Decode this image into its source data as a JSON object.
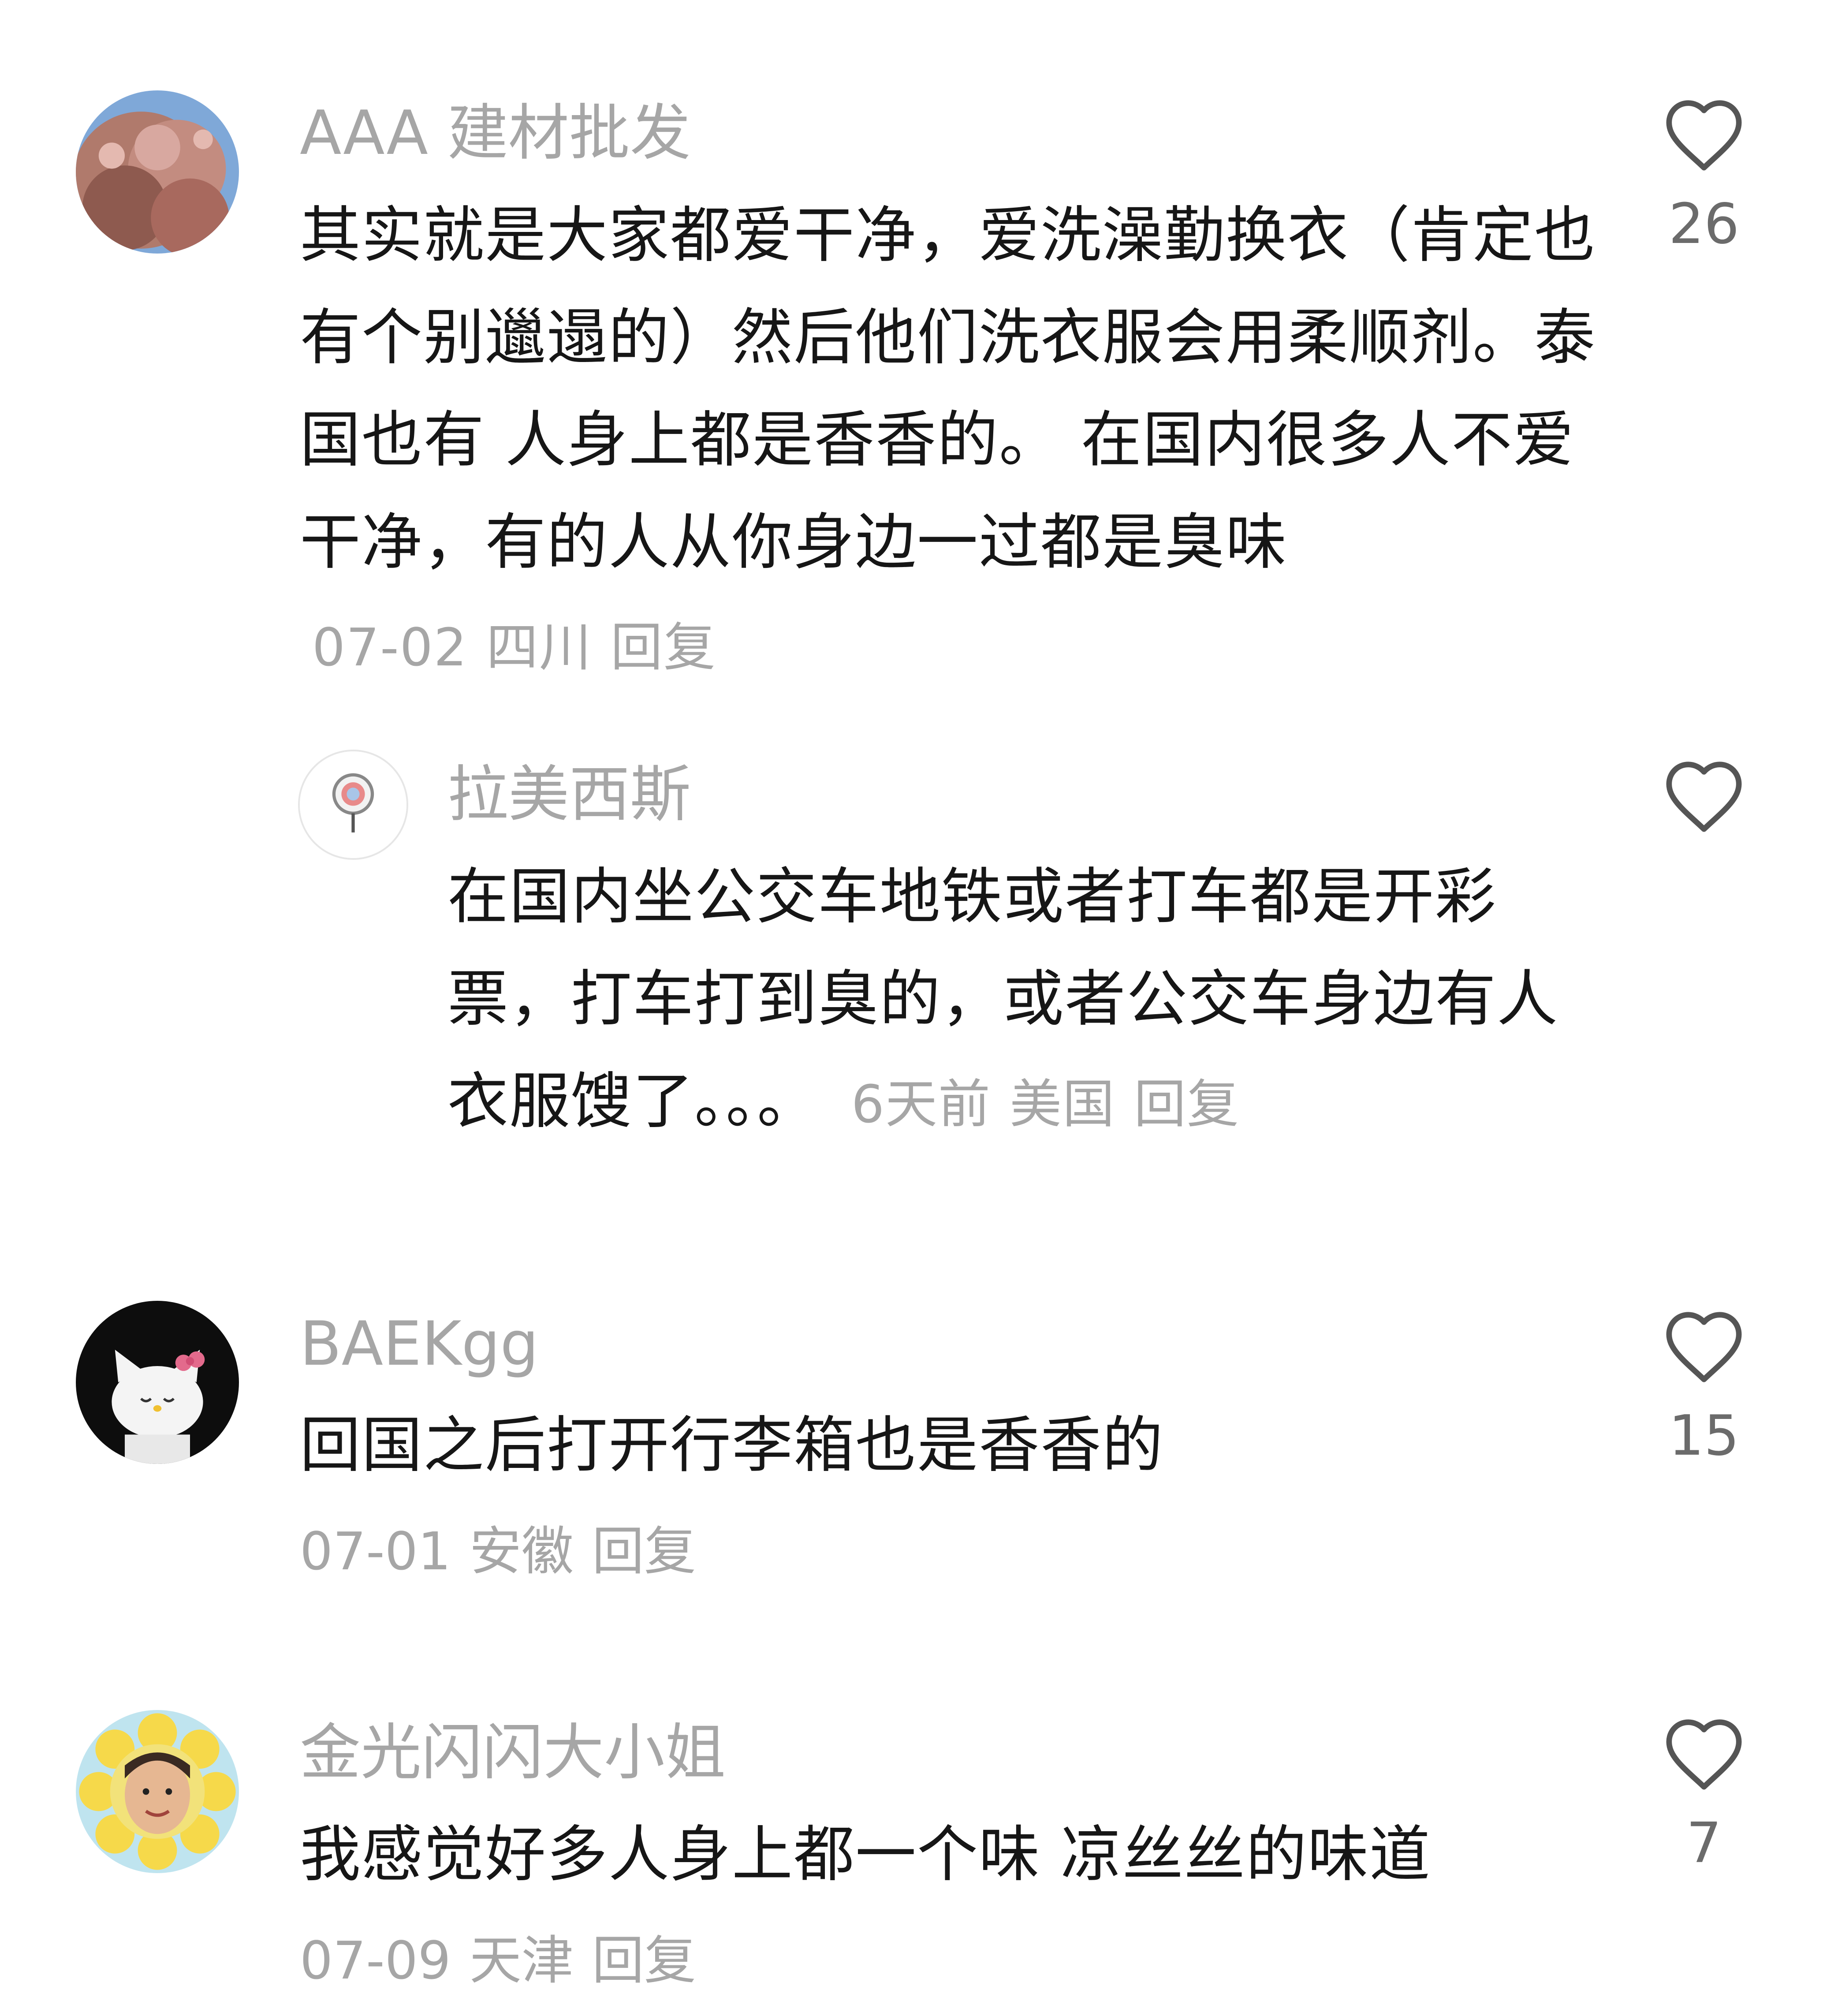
{
  "comments": [
    {
      "username": "AAA 建材批发",
      "text": "其实就是大家都爱干净，爱洗澡勤换衣（肯定也有个别邋遢的）然后他们洗衣服会用柔顺剂。泰国也有 人身上都是香香的。  在国内很多人不爱干净，有的人从你身边一过都是臭味",
      "date": "07-02",
      "location": "四川",
      "reply_label": "回复",
      "like_count": "26",
      "avatar_icon": "pink-blossom-tree-avatar",
      "replies": [
        {
          "username": "拉美西斯",
          "text": "在国内坐公交车地铁或者打车都是开彩票，打车打到臭的，或者公交车身边有人衣服馊了。。。",
          "date": "6天前",
          "location": "美国",
          "reply_label": "回复",
          "avatar_icon": "lollipop-avatar"
        }
      ]
    },
    {
      "username": "BAEKgg",
      "text": "回国之后打开行李箱也是香香的",
      "date": "07-01",
      "location": "安徽",
      "reply_label": "回复",
      "like_count": "15",
      "avatar_icon": "hello-kitty-avatar"
    },
    {
      "username": "金光闪闪大小姐",
      "text": "我感觉好多人身上都一个味  凉丝丝的味道",
      "date": "07-09",
      "location": "天津",
      "reply_label": "回复",
      "like_count": "7",
      "avatar_icon": "sunflower-face-avatar"
    }
  ],
  "colors": {
    "username": "#a6a6a6",
    "text": "#161616",
    "meta": "#a6a6a6",
    "like_icon": "#6b6b6b"
  }
}
